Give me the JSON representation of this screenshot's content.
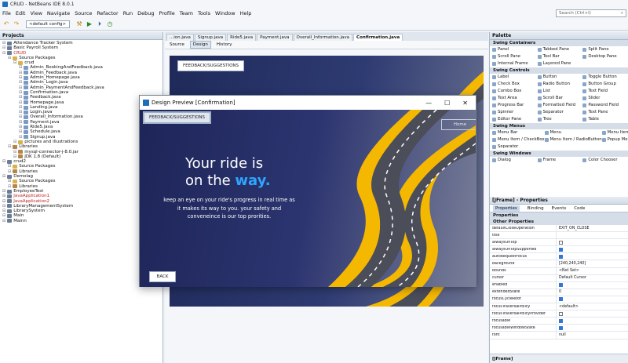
{
  "window": {
    "title": "CRUD - NetBeans IDE 8.0.1"
  },
  "menu": [
    "File",
    "Edit",
    "View",
    "Navigate",
    "Source",
    "Refactor",
    "Run",
    "Debug",
    "Profile",
    "Team",
    "Tools",
    "Window",
    "Help"
  ],
  "search": {
    "placeholder": "Search (Ctrl+I)"
  },
  "toolbar": {
    "config": "<default config>"
  },
  "projects": {
    "title": "Projects",
    "items": [
      {
        "label": "Attendance Tracker System",
        "level": 0,
        "type": "proj"
      },
      {
        "label": "Basic Payroll System",
        "level": 0,
        "type": "proj"
      },
      {
        "label": "CRUD",
        "level": 0,
        "type": "proj",
        "red": true
      },
      {
        "label": "Source Packages",
        "level": 1,
        "type": "pkg"
      },
      {
        "label": "crud",
        "level": 2,
        "type": "pkg"
      },
      {
        "label": "Admin_BookingAndFeedback.java",
        "level": 3,
        "type": "file"
      },
      {
        "label": "Admin_Feedback.java",
        "level": 3,
        "type": "file"
      },
      {
        "label": "Admin_Homepage.java",
        "level": 3,
        "type": "file"
      },
      {
        "label": "Admin_Login.java",
        "level": 3,
        "type": "file"
      },
      {
        "label": "Admin_PaymentAndFeedback.java",
        "level": 3,
        "type": "file"
      },
      {
        "label": "Confirmation.java",
        "level": 3,
        "type": "file"
      },
      {
        "label": "Feedback.java",
        "level": 3,
        "type": "file"
      },
      {
        "label": "Homepage.java",
        "level": 3,
        "type": "file"
      },
      {
        "label": "Landing.java",
        "level": 3,
        "type": "file"
      },
      {
        "label": "Login.java",
        "level": 3,
        "type": "file"
      },
      {
        "label": "Overall_Information.java",
        "level": 3,
        "type": "file"
      },
      {
        "label": "Payment.java",
        "level": 3,
        "type": "file"
      },
      {
        "label": "Ride5.java",
        "level": 3,
        "type": "file"
      },
      {
        "label": "Schedule.java",
        "level": 3,
        "type": "file"
      },
      {
        "label": "Signup.java",
        "level": 3,
        "type": "file"
      },
      {
        "label": "pictures and illustrations",
        "level": 2,
        "type": "pkg"
      },
      {
        "label": "Libraries",
        "level": 1,
        "type": "lib"
      },
      {
        "label": "mysql-connector-j-8.0.jar",
        "level": 2,
        "type": "lib"
      },
      {
        "label": "JDK 1.8 (Default)",
        "level": 2,
        "type": "lib"
      },
      {
        "label": "crud2",
        "level": 0,
        "type": "proj"
      },
      {
        "label": "Source Packages",
        "level": 1,
        "type": "pkg"
      },
      {
        "label": "Libraries",
        "level": 1,
        "type": "lib"
      },
      {
        "label": "Demolag",
        "level": 0,
        "type": "proj"
      },
      {
        "label": "Source Packages",
        "level": 1,
        "type": "pkg"
      },
      {
        "label": "Libraries",
        "level": 1,
        "type": "lib"
      },
      {
        "label": "EmployeeTest",
        "level": 0,
        "type": "proj"
      },
      {
        "label": "JavaApplication1",
        "level": 0,
        "type": "proj",
        "red": true
      },
      {
        "label": "JavaApplication2",
        "level": 0,
        "type": "proj",
        "red": true
      },
      {
        "label": "LibraryManagementSystem",
        "level": 0,
        "type": "proj"
      },
      {
        "label": "LibrarySystem",
        "level": 0,
        "type": "proj"
      },
      {
        "label": "Main",
        "level": 0,
        "type": "proj"
      },
      {
        "label": "Mainn",
        "level": 0,
        "type": "proj"
      }
    ]
  },
  "editor": {
    "tabs": [
      "...ion.java",
      "Signup.java",
      "Ride5.java",
      "Payment.java",
      "Overall_Information.java",
      "Confirmation.java"
    ],
    "active_tab": 5,
    "views": [
      "Source",
      "Design",
      "History"
    ],
    "active_view": 1,
    "form_button": "FEEDBACK/SUGGESTIONS"
  },
  "dialog": {
    "title": "Design Preview [Confirmation]",
    "feedback_button": "FEEDBACK/SUGGESTIONS",
    "home_button": "Home",
    "headline_line1": "Your ride is",
    "headline_line2_prefix": "on the ",
    "headline_line2_accent": "way.",
    "body": "keep an eye on your ride's progress in real time as it makes its way to you. your safety and conveneince is our top prorities.",
    "back_button": "BACK",
    "accent_color": "#2ea6ff"
  },
  "palette": {
    "title": "Palette",
    "groups": [
      {
        "name": "Swing Containers",
        "items": [
          "Panel",
          "Tabbed Pane",
          "Split Pane",
          "Scroll Pane",
          "Tool Bar",
          "Desktop Pane",
          "Internal Frame",
          "Layered Pane"
        ]
      },
      {
        "name": "Swing Controls",
        "items": [
          "Label",
          "Button",
          "Toggle Button",
          "Check Box",
          "Radio Button",
          "Button Group",
          "Combo Box",
          "List",
          "Text Field",
          "Text Area",
          "Scroll Bar",
          "Slider",
          "Progress Bar",
          "Formatted Field",
          "Password Field",
          "Spinner",
          "Separator",
          "Text Pane",
          "Editor Pane",
          "Tree",
          "Table"
        ]
      },
      {
        "name": "Swing Menus",
        "items": [
          "Menu Bar",
          "Menu",
          "Menu Item",
          "Menu Item / CheckBox",
          "Menu Item / RadioButton",
          "Popup Menu",
          "Separator"
        ]
      },
      {
        "name": "Swing Windows",
        "items": [
          "Dialog",
          "Frame",
          "Color Chooser"
        ]
      }
    ]
  },
  "properties": {
    "title": "[JFrame] - Properties",
    "tabs": [
      "Properties",
      "Binding",
      "Events",
      "Code"
    ],
    "active_tab": 0,
    "section1": "Properties",
    "section2": "Other Properties",
    "rows": [
      {
        "k": "defaultCloseOperation",
        "v": "EXIT_ON_CLOSE"
      },
      {
        "k": "title",
        "v": ""
      },
      {
        "k": "alwaysOnTop",
        "v": "",
        "chk": false
      },
      {
        "k": "alwaysOnTopSupported",
        "v": "",
        "chk": true
      },
      {
        "k": "autoRequestFocus",
        "v": "",
        "chk": true
      },
      {
        "k": "background",
        "v": "[240,240,240]"
      },
      {
        "k": "bounds",
        "v": "<Not Set>"
      },
      {
        "k": "cursor",
        "v": "Default Cursor"
      },
      {
        "k": "enabled",
        "v": "",
        "chk": true
      },
      {
        "k": "extendedState",
        "v": "0"
      },
      {
        "k": "focusCycleRoot",
        "v": "",
        "chk": true
      },
      {
        "k": "focusTraversalPolicy",
        "v": "<default>"
      },
      {
        "k": "focusTraversalPolicyProvider",
        "v": "",
        "chk": false
      },
      {
        "k": "focusable",
        "v": "",
        "chk": true
      },
      {
        "k": "focusableWindowState",
        "v": "",
        "chk": true
      },
      {
        "k": "font",
        "v": "null"
      }
    ],
    "footer": "[JFrame]"
  }
}
